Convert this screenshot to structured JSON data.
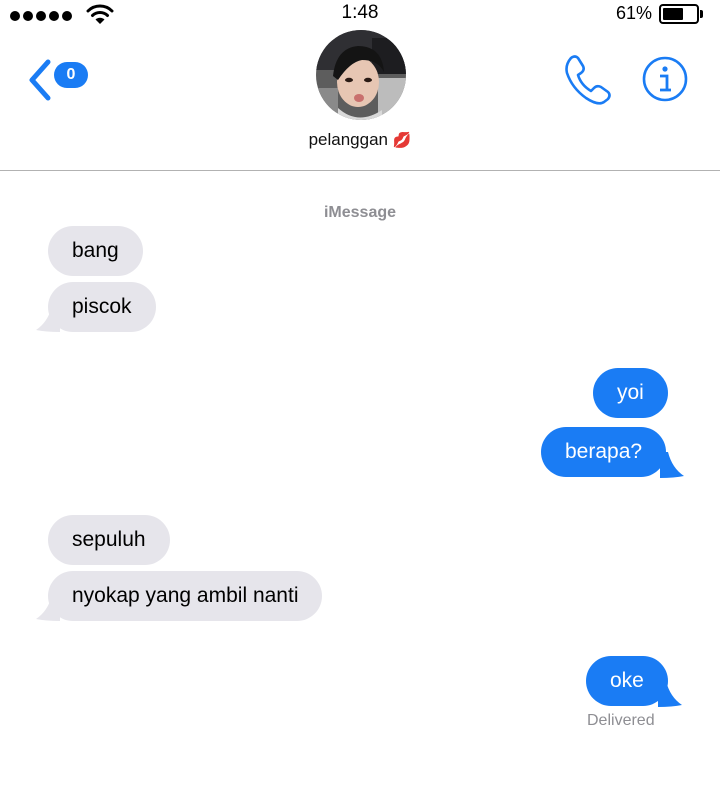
{
  "status_bar": {
    "time": "1:48",
    "battery_percent": "61%",
    "battery_level": 0.61,
    "signal_dots": 5
  },
  "header": {
    "back_count": "0",
    "contact_name": "pelanggan",
    "contact_emoji": "💋",
    "accent_color": "#1a7cf4"
  },
  "conversation": {
    "service": "iMessage",
    "messages": [
      {
        "from": "them",
        "text": "bang"
      },
      {
        "from": "them",
        "text": "piscok"
      },
      {
        "from": "me",
        "text": "yoi"
      },
      {
        "from": "me",
        "text": "berapa?"
      },
      {
        "from": "them",
        "text": "sepuluh"
      },
      {
        "from": "them",
        "text": "nyokap yang ambil nanti"
      },
      {
        "from": "me",
        "text": "oke"
      }
    ],
    "delivery_status": "Delivered"
  },
  "icons": [
    "back-chevron-icon",
    "wifi-icon",
    "phone-icon",
    "info-icon",
    "avatar"
  ]
}
